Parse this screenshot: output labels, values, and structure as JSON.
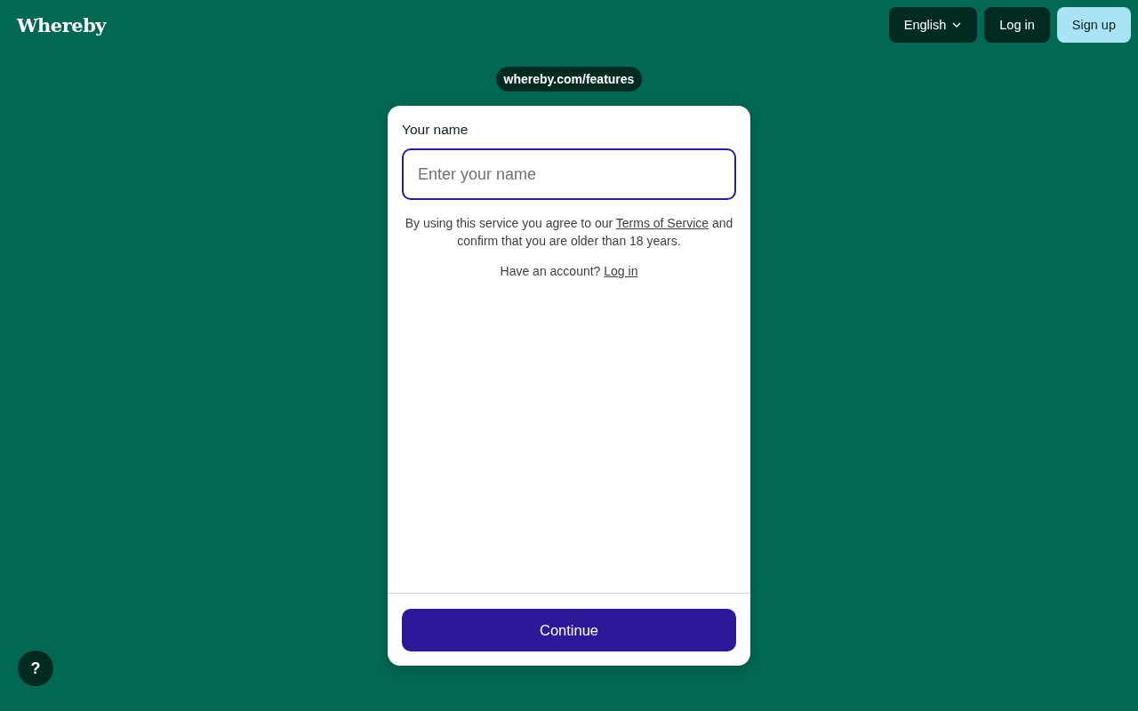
{
  "header": {
    "logo": "Whereby",
    "language": "English",
    "login": "Log in",
    "signup": "Sign up"
  },
  "room_url": "whereby.com/features",
  "form": {
    "label": "Your name",
    "name_field": {
      "placeholder": "Enter your name",
      "focused": true
    },
    "terms": {
      "before": "By using this service you agree to our ",
      "link": "Terms of Service",
      "after": " and confirm that you are older than 18 years."
    },
    "account": {
      "text": "Have an account? ",
      "link": "Log in"
    },
    "continue": "Continue"
  },
  "help": "?"
}
